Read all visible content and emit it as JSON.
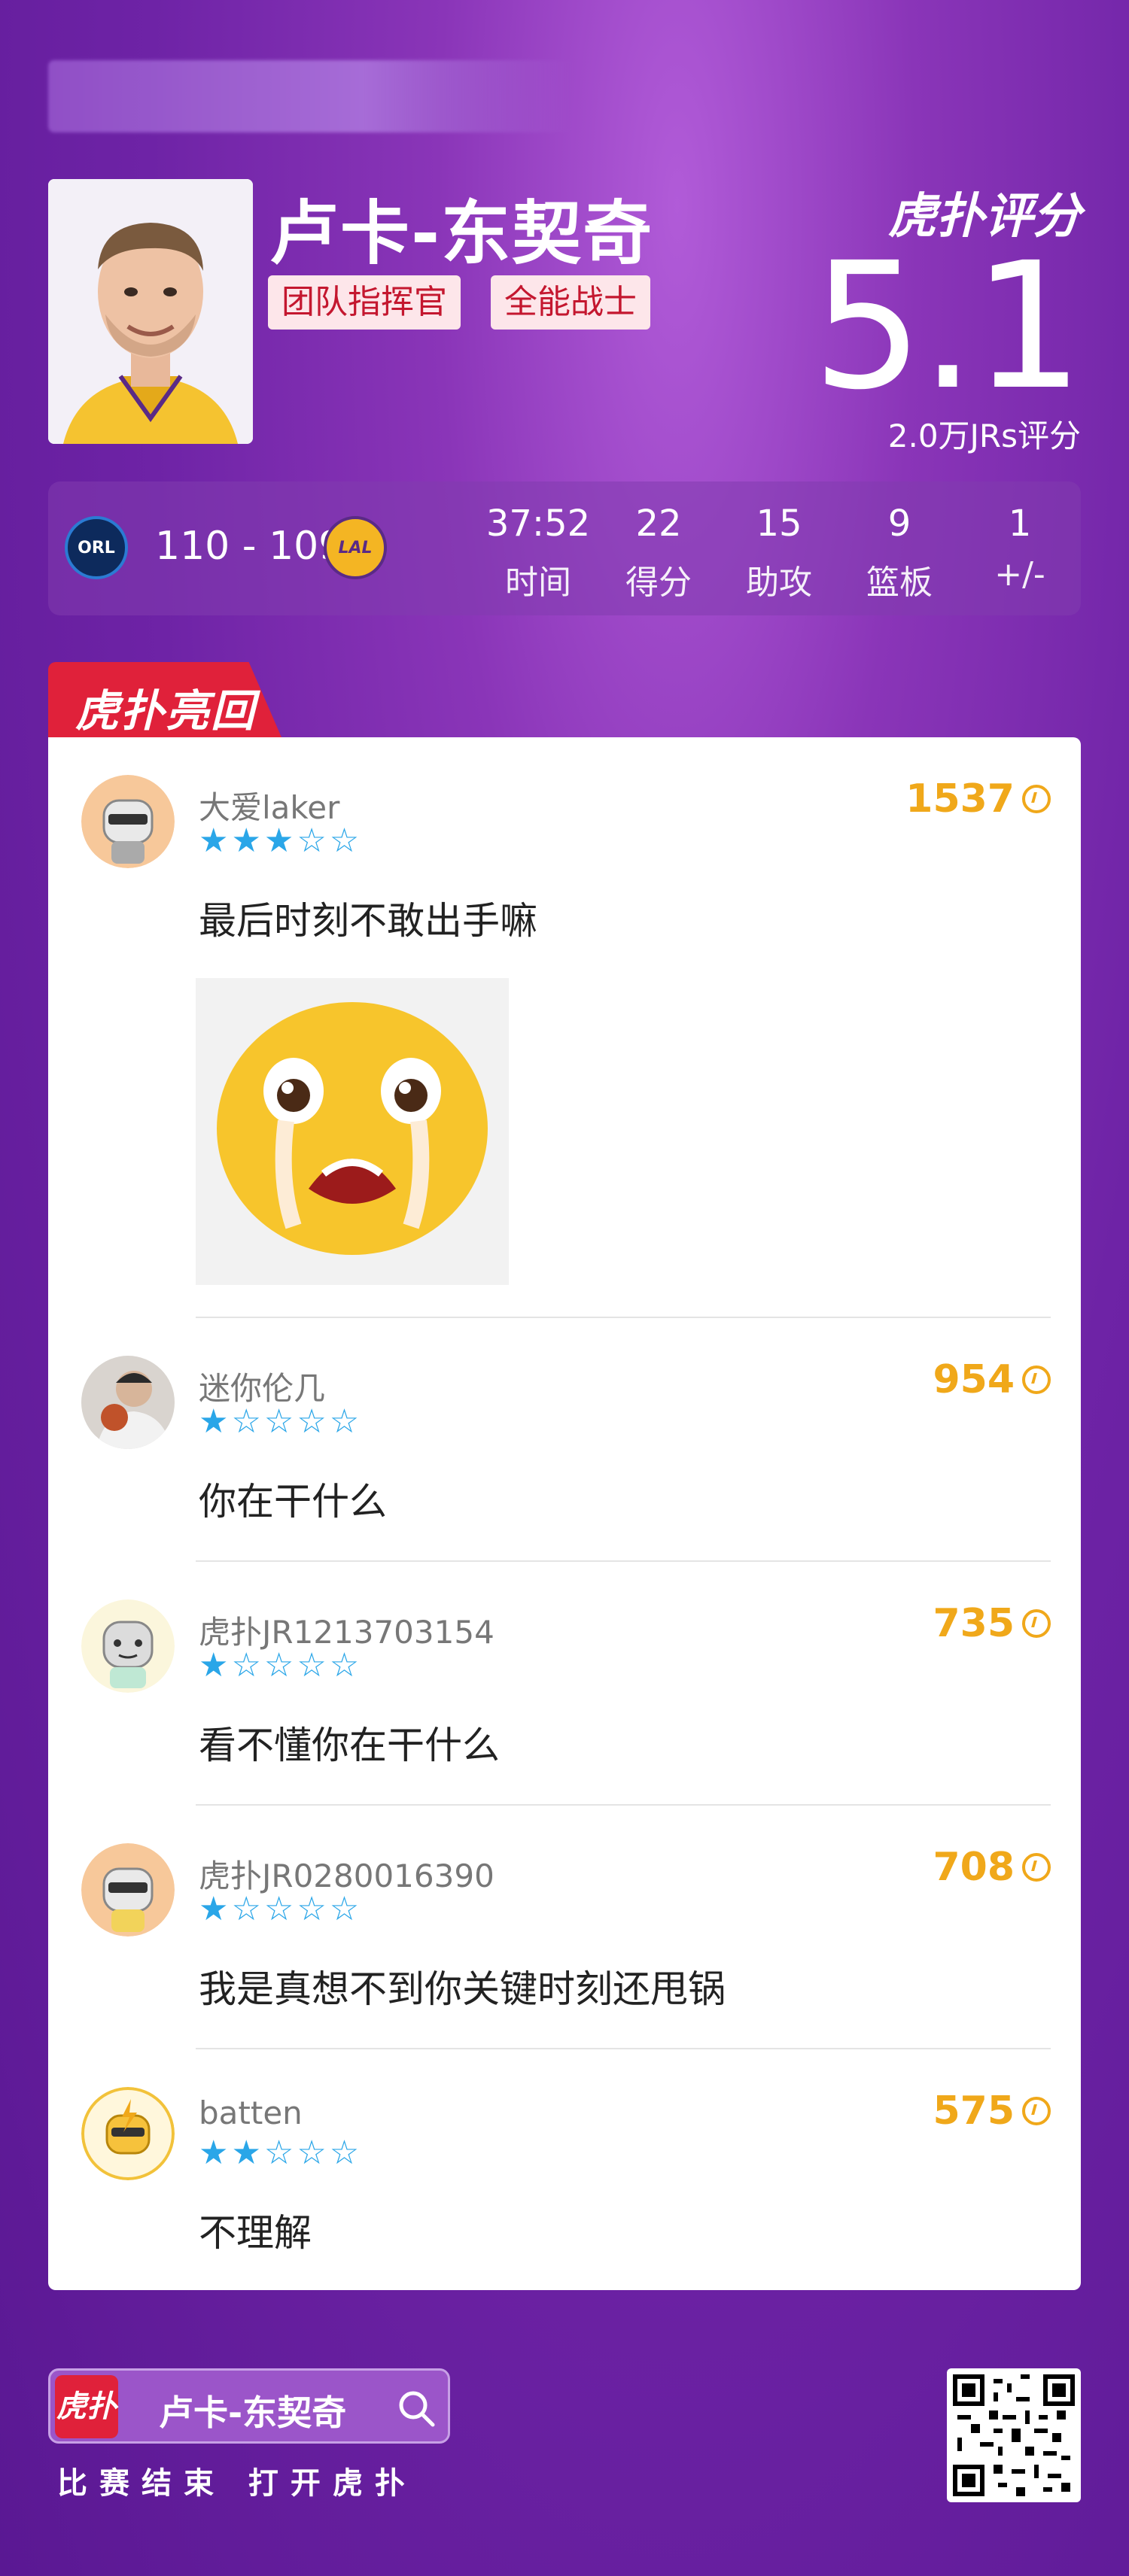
{
  "player": {
    "name": "卢卡-东契奇",
    "tags": [
      "团队指挥官",
      "全能战士"
    ]
  },
  "rating": {
    "brand": "虎扑评分",
    "score": "5.1",
    "count_label": "2.0万JRs评分"
  },
  "game": {
    "home_abbr": "ORL",
    "away_abbr": "LAL",
    "score": "110 - 109",
    "stats": [
      {
        "value": "37:52",
        "label": "时间"
      },
      {
        "value": "22",
        "label": "得分"
      },
      {
        "value": "15",
        "label": "助攻"
      },
      {
        "value": "9",
        "label": "篮板"
      },
      {
        "value": "1",
        "label": "+/-"
      }
    ]
  },
  "section_title": "虎扑亮回复",
  "comments": [
    {
      "user": "大爱laker",
      "stars": 3,
      "text": "最后时刻不敢出手嘛",
      "likes": "1537",
      "avatar": "robot-sunglasses-icon"
    },
    {
      "user": "迷你伦几",
      "stars": 1,
      "text": "你在干什么",
      "likes": "954",
      "avatar": "photo-avatar"
    },
    {
      "user": "虎扑JR1213703154",
      "stars": 1,
      "text": "看不懂你在干什么",
      "likes": "735",
      "avatar": "robot-grey-icon"
    },
    {
      "user": "虎扑JR0280016390",
      "stars": 1,
      "text": "我是真想不到你关键时刻还甩锅",
      "likes": "708",
      "avatar": "robot-sunglasses-icon"
    },
    {
      "user": "batten",
      "stars": 2,
      "text": "不理解",
      "likes": "575",
      "avatar": "lightning-robot-icon"
    }
  ],
  "footer": {
    "logo_text": "虎扑",
    "search_name": "卢卡-东契奇",
    "caption": "比赛结束 打开虎扑"
  },
  "colors": {
    "accent_red": "#e0213a",
    "star_blue": "#2aa6e8",
    "like_gold": "#f0a81a"
  }
}
